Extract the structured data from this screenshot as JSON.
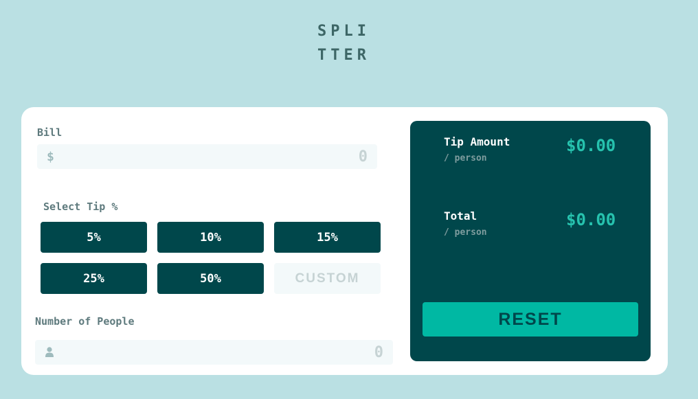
{
  "app": {
    "logo_line1": "SPLI",
    "logo_line2": "TTER"
  },
  "bill": {
    "label": "Bill",
    "prefix": "$",
    "value": "0"
  },
  "tip": {
    "label": "Select Tip %",
    "options": [
      "5%",
      "10%",
      "15%",
      "25%",
      "50%"
    ],
    "custom_placeholder": "CUSTOM"
  },
  "people": {
    "label": "Number of People",
    "value": "0",
    "icon": "person-icon"
  },
  "results": {
    "tip_amount_label": "Tip Amount",
    "tip_amount_sub": "/ person",
    "tip_amount_value": "$0.00",
    "total_label": "Total",
    "total_sub": "/ person",
    "total_value": "$0.00",
    "reset_label": "RESET"
  },
  "colors": {
    "background": "#bae0e3",
    "dark_cyan": "#00474b",
    "strong_cyan": "#26c2ae",
    "input_bg": "#f3f9fa"
  }
}
